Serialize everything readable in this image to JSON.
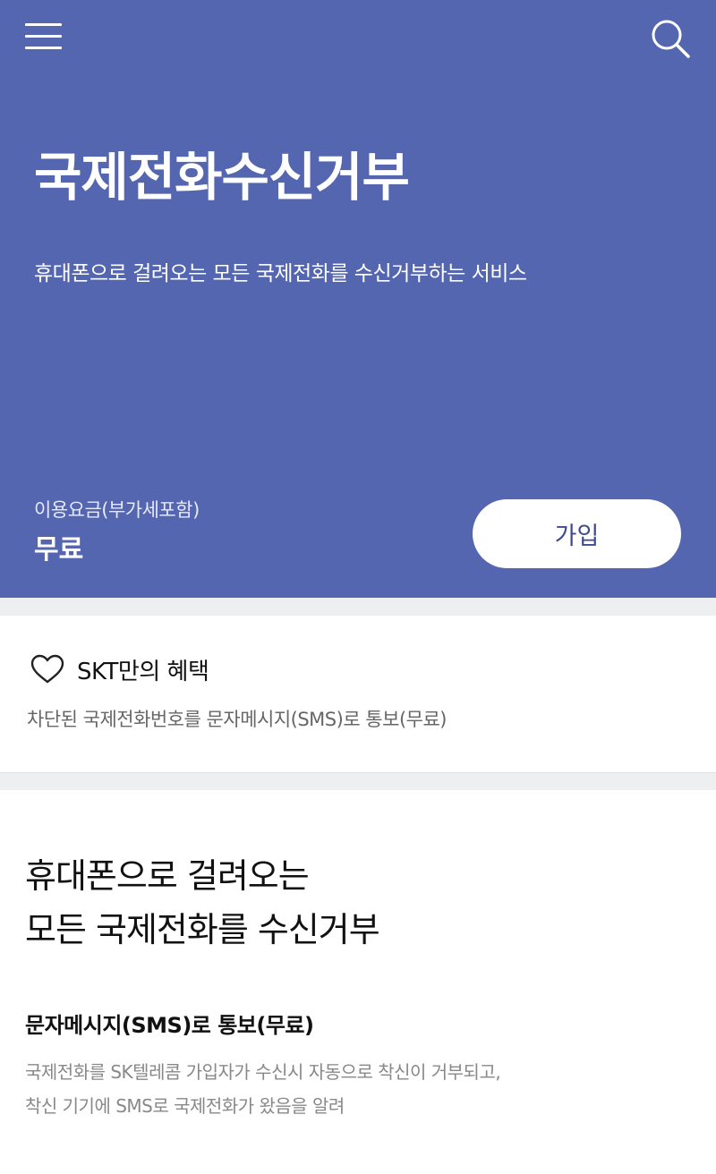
{
  "header": {
    "menu_icon": "hamburger-menu-icon",
    "search_icon": "search-icon"
  },
  "hero": {
    "title": "국제전화수신거부",
    "description": "휴대폰으로 걸려오는 모든 국제전화를 수신거부하는 서비스",
    "fee_label": "이용요금(부가세포함)",
    "fee_value": "무료",
    "join_label": "가입",
    "background_color": "#5566b1"
  },
  "benefit": {
    "icon": "heart-icon",
    "title": "SKT만의 혜택",
    "description": "차단된 국제전화번호를 문자메시지(SMS)로 통보(무료)"
  },
  "detail": {
    "title_line1": "휴대폰으로 걸려오는",
    "title_line2": "모든 국제전화를 수신거부",
    "subtitle": "문자메시지(SMS)로 통보(무료)",
    "desc_line1": "국제전화를 SK텔레콤 가입자가 수신시 자동으로 착신이 거부되고,",
    "desc_line2": "착신 기기에 SMS로 국제전화가 왔음을 알려"
  }
}
